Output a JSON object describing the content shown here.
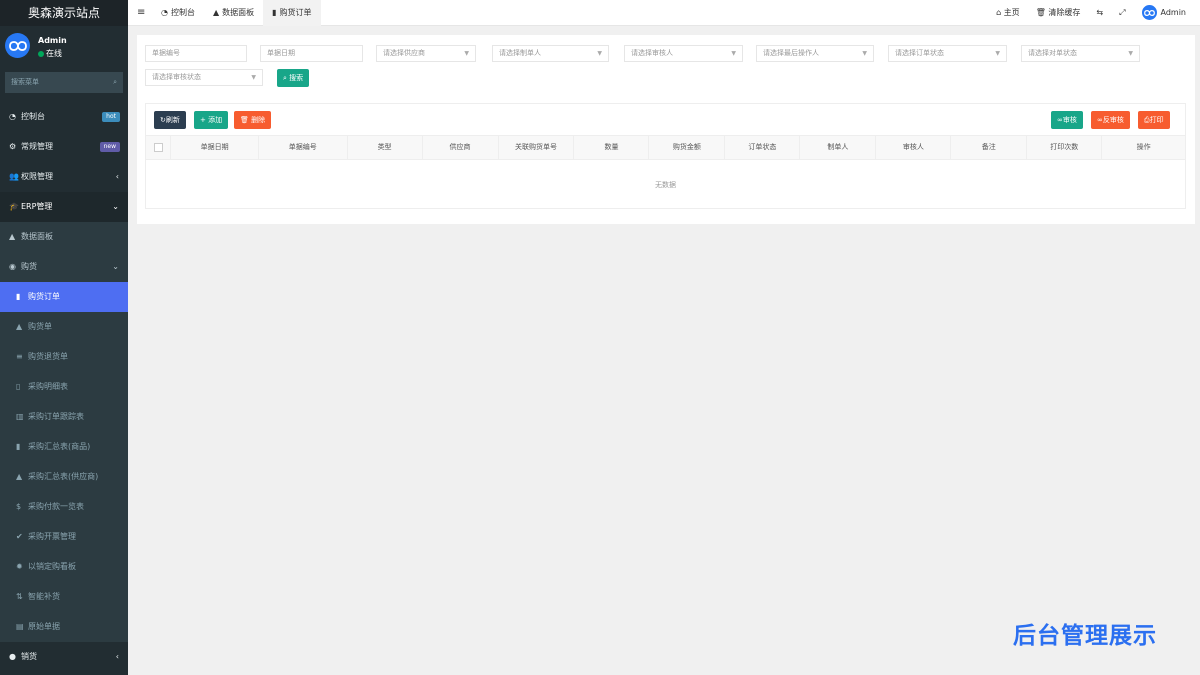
{
  "app": {
    "title": "奥森演示站点"
  },
  "user": {
    "name": "Admin",
    "status": "在线"
  },
  "sidebar": {
    "search_placeholder": "搜索菜单",
    "items": [
      {
        "label": "控制台",
        "icon": "dashboard-icon",
        "glyph": "◔",
        "badge": "hot",
        "badge_color": "#3c8dbc"
      },
      {
        "label": "常规管理",
        "icon": "cogs-icon",
        "glyph": "⚙",
        "badge": "new",
        "badge_color": "#605ca8"
      },
      {
        "label": "权限管理",
        "icon": "group-icon",
        "glyph": "👥",
        "chevron": "‹"
      },
      {
        "label": "ERP管理",
        "icon": "graduation-cap-icon",
        "glyph": "🎓",
        "chevron": "⌄"
      },
      {
        "label": "数据面板",
        "icon": "area-chart-icon",
        "glyph": "▲"
      },
      {
        "label": "购货",
        "icon": "github-icon",
        "glyph": "◉",
        "chevron": "⌄"
      },
      {
        "label": "购货订单",
        "icon": "bar-chart-icon",
        "glyph": "▮"
      },
      {
        "label": "购货单",
        "icon": "area-chart-icon",
        "glyph": "▲"
      },
      {
        "label": "购货退货单",
        "icon": "database-icon",
        "glyph": "≡"
      },
      {
        "label": "采购明细表",
        "icon": "file-text-icon",
        "glyph": "▯"
      },
      {
        "label": "采购订单跟踪表",
        "icon": "building-icon",
        "glyph": "▥"
      },
      {
        "label": "采购汇总表(商品)",
        "icon": "bar-chart-icon",
        "glyph": "▮"
      },
      {
        "label": "采购汇总表(供应商)",
        "icon": "area-chart-icon",
        "glyph": "▲"
      },
      {
        "label": "采购付款一览表",
        "icon": "dollar-icon",
        "glyph": "$"
      },
      {
        "label": "采购开票管理",
        "icon": "check-circle-icon",
        "glyph": "✔"
      },
      {
        "label": "以销定购看板",
        "icon": "gear-icon",
        "glyph": "✹"
      },
      {
        "label": "智能补货",
        "icon": "sort-amount-icon",
        "glyph": "⇅"
      },
      {
        "label": "原始单据",
        "icon": "clipboard-icon",
        "glyph": "▤"
      },
      {
        "label": "销货",
        "icon": "apple-icon",
        "glyph": "●",
        "chevron": "‹"
      }
    ]
  },
  "topbar": {
    "tabs": [
      {
        "label": "控制台",
        "icon": "dashboard-icon",
        "glyph": "◔"
      },
      {
        "label": "数据面板",
        "icon": "area-chart-icon",
        "glyph": "▲"
      },
      {
        "label": "购货订单",
        "icon": "bar-chart-icon",
        "glyph": "▮"
      }
    ],
    "home": "主页",
    "clear_cache": "清除缓存",
    "admin": "Admin"
  },
  "filters": {
    "bill_no": "单据编号",
    "bill_date": "单据日期",
    "supplier": "请选择供应商",
    "creator": "请选择制单人",
    "auditor": "请选择审核人",
    "last_operator": "请选择最后操作人",
    "order_status": "请选择订单状态",
    "reconcile_status": "请选择对单状态",
    "audit_status": "请选择审核状态",
    "search_btn": "搜索"
  },
  "toolbar": {
    "refresh": "刷新",
    "add": "添加",
    "delete": "删除",
    "audit": "审核",
    "unaudit": "反审核",
    "print": "打印"
  },
  "table": {
    "columns": [
      "单据日期",
      "单据编号",
      "类型",
      "供应商",
      "关联购货单号",
      "数量",
      "购货金额",
      "订单状态",
      "制单人",
      "审核人",
      "备注",
      "打印次数",
      "操作"
    ],
    "empty": "无数据"
  },
  "watermark": "后台管理展示"
}
